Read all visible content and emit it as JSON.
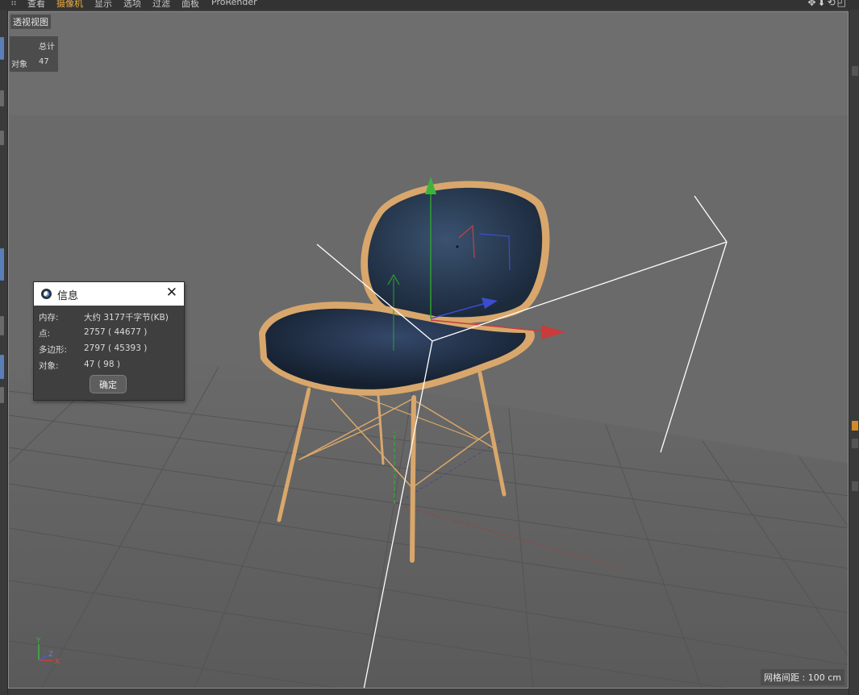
{
  "menubar": {
    "items": [
      {
        "label": "查看",
        "active": false
      },
      {
        "label": "摄像机",
        "active": true
      },
      {
        "label": "显示",
        "active": false
      },
      {
        "label": "选项",
        "active": false
      },
      {
        "label": "过滤",
        "active": false
      },
      {
        "label": "面板",
        "active": false
      },
      {
        "label": "ProRender",
        "active": false
      }
    ],
    "nav_icons": [
      "move-view-icon",
      "rotate-view-icon",
      "zoom-view-icon",
      "fullscreen-icon"
    ]
  },
  "viewport": {
    "view_name": "透视视图",
    "stats": {
      "header": "总计",
      "label": "对象",
      "value": "47"
    },
    "grid_spacing": "网格间距 : 100 cm",
    "axis": {
      "y": "Y",
      "z": "Z",
      "x": "X"
    }
  },
  "dialog": {
    "title": "信息",
    "rows": [
      {
        "label": "内存:",
        "value": "大约 3177千字节(KB)"
      },
      {
        "label": "点:",
        "value": "2757 ( 44677 )"
      },
      {
        "label": "多边形:",
        "value": "2797 ( 45393 )"
      },
      {
        "label": "对象:",
        "value": "47 ( 98 )"
      }
    ],
    "ok_label": "确定"
  },
  "colors": {
    "seat_fabric": "#24344b",
    "wood": "#d9a76c",
    "axis_x": "#c83c3c",
    "axis_y": "#3cb43c",
    "axis_z": "#3c4cd0",
    "accent": "#f0b040"
  }
}
